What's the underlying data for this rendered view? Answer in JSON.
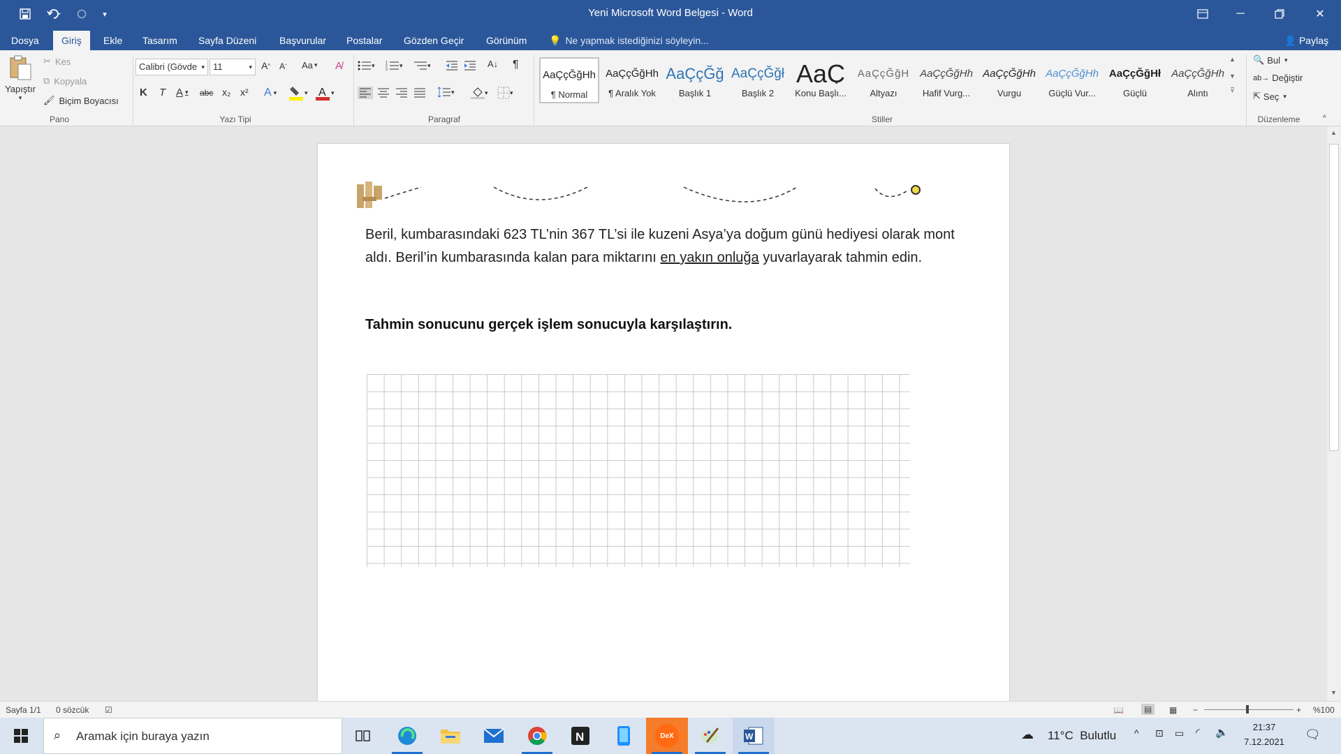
{
  "window": {
    "title": "Yeni Microsoft Word Belgesi - Word"
  },
  "tabs": {
    "file": "Dosya",
    "items": [
      "Giriş",
      "Ekle",
      "Tasarım",
      "Sayfa Düzeni",
      "Başvurular",
      "Postalar",
      "Gözden Geçir",
      "Görünüm"
    ],
    "active": "Giriş",
    "tell_me": "Ne yapmak istediğinizi söyleyin...",
    "share": "Paylaş"
  },
  "ribbon": {
    "clipboard": {
      "paste": "Yapıştır",
      "cut": "Kes",
      "copy": "Kopyala",
      "format_painter": "Biçim Boyacısı",
      "label": "Pano"
    },
    "font": {
      "family": "Calibri (Gövde",
      "size": "11",
      "case_label": "Aa",
      "bold": "K",
      "italic": "T",
      "underline": "A",
      "strike": "abc",
      "subscript": "x₂",
      "superscript": "x²",
      "label": "Yazı Tipi",
      "font_color": "#d32f2f",
      "highlight_color": "#ffef00"
    },
    "paragraph": {
      "label": "Paragraf"
    },
    "styles": {
      "label": "Stiller",
      "items": [
        {
          "sample": "AaÇçĞğHh",
          "name": "¶ Normal"
        },
        {
          "sample": "AaÇçĞğHh",
          "name": "¶ Aralık Yok"
        },
        {
          "sample": "AaÇçĞğ",
          "name": "Başlık 1"
        },
        {
          "sample": "AaÇçĞğł",
          "name": "Başlık 2"
        },
        {
          "sample": "AaÇ",
          "name": "Konu Başlı..."
        },
        {
          "sample": "AaÇçĞğH",
          "name": "Altyazı"
        },
        {
          "sample": "AaÇçĞğHh",
          "name": "Hafif Vurg..."
        },
        {
          "sample": "AaÇçĞğHh",
          "name": "Vurgu"
        },
        {
          "sample": "AaÇçĞğHh",
          "name": "Güçlü Vur..."
        },
        {
          "sample": "AaÇçĞğHł",
          "name": "Güçlü"
        },
        {
          "sample": "AaÇçĞğHh",
          "name": "Alıntı"
        }
      ]
    },
    "editing": {
      "find": "Bul",
      "replace": "Değiştir",
      "select": "Seç",
      "label": "Düzenleme"
    }
  },
  "document": {
    "paragraph_before": "Beril, kumbarasındaki 623 TL’nin 367 TL’si ile kuzeni Asya’ya doğum günü hediyesi olarak mont aldı. Beril’in kumbarasında kalan para miktarını ",
    "paragraph_underlined": "en yakın onluğa",
    "paragraph_after": " yuvarlayarak tahmin edin.",
    "heading": "Tahmin sonucunu gerçek işlem sonucuyla karşılaştırın."
  },
  "status": {
    "page": "Sayfa 1/1",
    "words": "0 sözcük",
    "zoom": "%100"
  },
  "taskbar": {
    "search_placeholder": "Aramak için buraya yazın",
    "weather_temp": "11°C",
    "weather_desc": "Bulutlu",
    "time": "21:37",
    "date": "7.12.2021",
    "dex_label": "DeX"
  }
}
